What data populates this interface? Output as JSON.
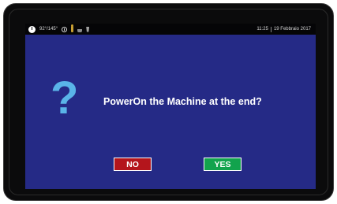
{
  "statusbar": {
    "temperature": "92°/145°",
    "time": "11:25",
    "date": "19 Febbraio 2017",
    "icons": [
      "power-icon",
      "clock-icon",
      "person-icon",
      "cup-icon",
      "glass-icon"
    ]
  },
  "dialog": {
    "icon": "question-mark-icon",
    "icon_glyph": "?",
    "message": "PowerOn the Machine at the end?",
    "no_label": "NO",
    "yes_label": "YES"
  },
  "colors": {
    "screen_background": "#252a86",
    "statusbar_background": "#050507",
    "question_mark": "#5ab4e8",
    "no_button": "#b4151c",
    "yes_button": "#12a34d",
    "device_bezel": "#0b0b0c"
  }
}
